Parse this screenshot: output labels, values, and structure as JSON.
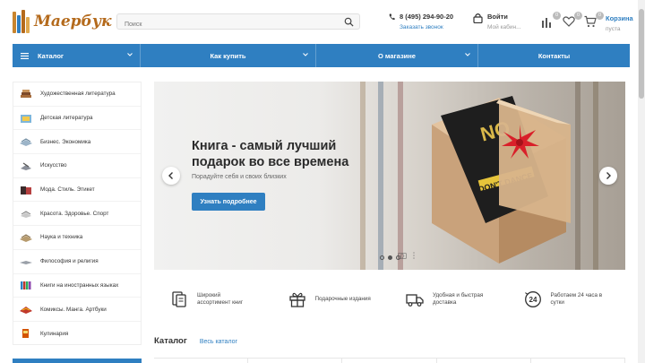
{
  "header": {
    "logo_text": "Маербук",
    "search_placeholder": "Поиск",
    "phone": "8 (495) 294-90-20",
    "callback_label": "Заказать звонок",
    "login_title": "Войти",
    "login_sub": "Мой кабин...",
    "compare_count": "0",
    "favorites_count": "0",
    "cart_count": "0",
    "cart_title": "Корзина",
    "cart_sub": "пуста"
  },
  "nav": {
    "items": [
      {
        "label": "Каталог"
      },
      {
        "label": "Как купить"
      },
      {
        "label": "О магазине"
      },
      {
        "label": "Контакты"
      }
    ]
  },
  "sidebar": {
    "items": [
      {
        "label": "Художественная литература",
        "icon": "books-stack-icon"
      },
      {
        "label": "Детская литература",
        "icon": "kids-book-icon"
      },
      {
        "label": "Бизнес. Экономика",
        "icon": "business-book-icon"
      },
      {
        "label": "Искусство",
        "icon": "art-book-icon"
      },
      {
        "label": "Мода. Стиль. Этикет",
        "icon": "fashion-book-icon"
      },
      {
        "label": "Красота. Здоровье. Спорт",
        "icon": "beauty-book-icon"
      },
      {
        "label": "Наука и техника",
        "icon": "science-book-icon"
      },
      {
        "label": "Философия и религия",
        "icon": "philosophy-book-icon"
      },
      {
        "label": "Книги на иностранных языках",
        "icon": "foreign-books-icon"
      },
      {
        "label": "Комиксы. Манга. Артбуки",
        "icon": "comics-icon"
      },
      {
        "label": "Кулинария",
        "icon": "cooking-book-icon"
      }
    ]
  },
  "banner": {
    "title_line1": "Книга - самый лучший",
    "title_line2": "подарок во все времена",
    "subtitle": "Порадуйте себя и своих близких",
    "button_label": "Узнать подробнее",
    "slide_count": 3,
    "active_slide": 2
  },
  "features": [
    {
      "line1": "Широкий",
      "line2": "ассортимент книг",
      "icon": "books-icon"
    },
    {
      "line1": "Подарочные издания",
      "line2": "",
      "icon": "gift-icon"
    },
    {
      "line1": "Удобная и быстрая",
      "line2": "доставка",
      "icon": "truck-icon"
    },
    {
      "line1": "Работаем 24 часа в",
      "line2": "сутки",
      "icon": "clock-24-icon"
    }
  ],
  "catalog": {
    "title": "Каталог",
    "all_link": "Весь каталог"
  },
  "colors": {
    "accent": "#2f7fc1",
    "badge": "#bbbbbb",
    "gift_box": "#d9b48c",
    "bow": "#d9202a"
  }
}
